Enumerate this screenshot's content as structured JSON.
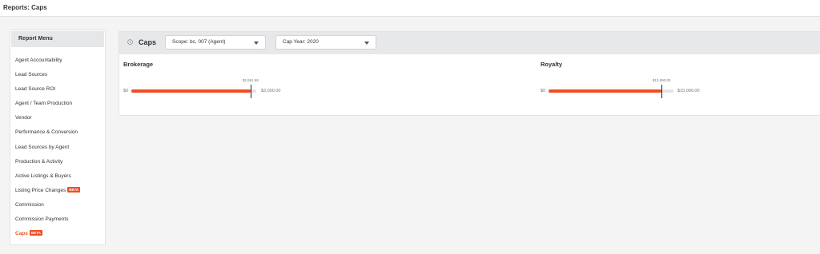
{
  "page": {
    "title": "Reports: Caps"
  },
  "sidebar": {
    "header": "Report Menu",
    "items": [
      {
        "label": "Agent Accountability",
        "beta": ""
      },
      {
        "label": "Lead Sources",
        "beta": ""
      },
      {
        "label": "Lead Source ROI",
        "beta": ""
      },
      {
        "label": "Agent / Team Production",
        "beta": ""
      },
      {
        "label": "Vendor",
        "beta": ""
      },
      {
        "label": "Performance & Conversion",
        "beta": ""
      },
      {
        "label": "Lead Sources by Agent",
        "beta": ""
      },
      {
        "label": "Production & Activity",
        "beta": ""
      },
      {
        "label": "Active Listings & Buyers",
        "beta": ""
      },
      {
        "label": "Listing Price Changes",
        "beta": "BETA"
      },
      {
        "label": "Commission",
        "beta": ""
      },
      {
        "label": "Commission Payments",
        "beta": ""
      },
      {
        "label": "Caps",
        "beta": "BETA",
        "active": true
      }
    ]
  },
  "caps_panel": {
    "title": "Caps",
    "info_icon": "info-circle-icon",
    "scope_dropdown": {
      "label": "Scope: bc, 007 (Agent)"
    },
    "cap_year_dropdown": {
      "label": "Cap Year: 2020"
    },
    "brokerage": {
      "title": "Brokerage",
      "min_label": "$0",
      "current_label": "$2,861.88",
      "cap_label": "$3,000.00",
      "current_value": 2861.88,
      "cap_value": 3000
    },
    "royalty": {
      "title": "Royalty",
      "min_label": "$0",
      "current_label": "$13,590.00",
      "cap_label": "$15,000.00",
      "current_value": 13590,
      "cap_value": 15000
    }
  },
  "colors": {
    "accent": "#f04e23",
    "track": "#e3e3e3",
    "header_bg": "#e7e8ea"
  }
}
